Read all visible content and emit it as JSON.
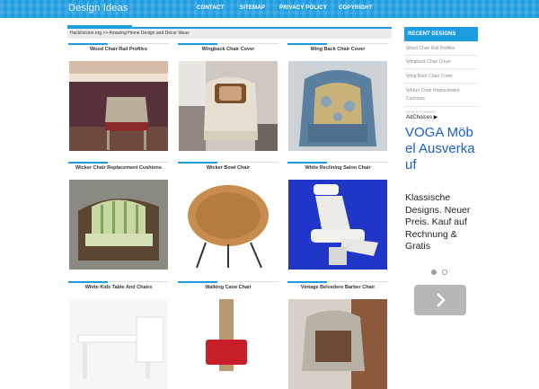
{
  "header": {
    "site_title": "Design Ideas",
    "nav": [
      "CONTACT",
      "SITEMAP",
      "PRIVACY POLICY",
      "COPYRIGHT"
    ],
    "accent_color": "#1e9ce0"
  },
  "breadcrumb": "Hacklivision.org >> Amazing Home Design and Decor Ideas",
  "grid": [
    {
      "caption": "Wood Chair Rail Profiles"
    },
    {
      "caption": "Wingback Chair Cover"
    },
    {
      "caption": "Wing Back Chair Cover"
    },
    {
      "caption": "Wicker Chair Replacement Cushions"
    },
    {
      "caption": "Wicker Bowl Chair"
    },
    {
      "caption": "White Reclining Salon Chair"
    },
    {
      "caption": "White Kids Table And Chairs"
    },
    {
      "caption": "Walking Cane Chair"
    },
    {
      "caption": "Vintage Belvedere Barber Chair"
    }
  ],
  "sidebar": {
    "heading": "RECENT DESIGNS",
    "links": [
      "Wood Chair Rail Profiles",
      "Wingback Chair Cover",
      "Wing Back Chair Cover",
      "Wicker Chair Replacement Cushions"
    ]
  },
  "ad": {
    "small_label": "ADVERTISEMENT",
    "adchoices": "AdChoices",
    "title": "VOGA Möbel Ausverkauf",
    "text": "Klassische Designs. Neuer Preis. Kauf auf Rechnung & Gratis",
    "next_icon": "chevron-right-icon"
  }
}
